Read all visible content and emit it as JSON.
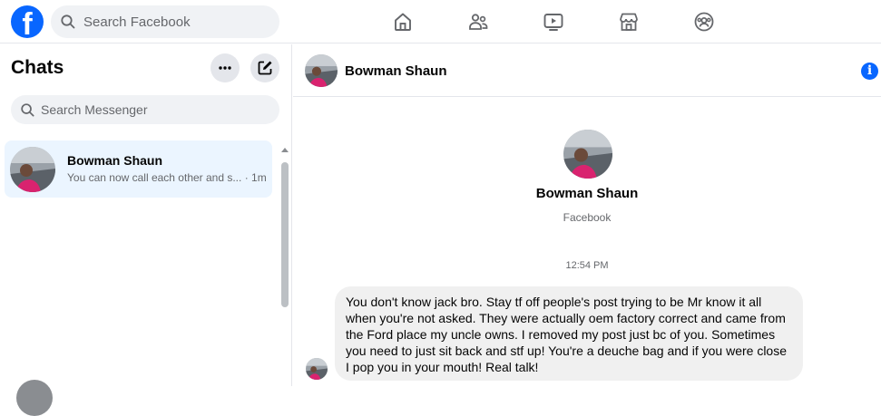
{
  "topbar": {
    "logo_letter": "f",
    "search_placeholder": "Search Facebook",
    "nav": [
      "home-icon",
      "friends-icon",
      "watch-icon",
      "marketplace-icon",
      "groups-icon"
    ]
  },
  "sidebar": {
    "title": "Chats",
    "search_placeholder": "Search Messenger",
    "conversations": [
      {
        "name": "Bowman Shaun",
        "preview": "You can now call each other and s...",
        "time": "· 1m",
        "selected": true
      }
    ]
  },
  "chat": {
    "header_name": "Bowman Shaun",
    "profile_name": "Bowman Shaun",
    "profile_subtitle": "Facebook",
    "timestamp": "12:54 PM",
    "messages": [
      {
        "sender": "Bowman Shaun",
        "text": "You don't know jack bro. Stay tf off people's post trying to be Mr know it all when you're not asked. They were actually oem factory correct and came from the Ford place my uncle owns. I removed my post just bc of you. Sometimes you need to just sit back and stf up! You're a deuche bag and if you were close I pop you in your mouth! Real talk!"
      }
    ]
  },
  "colors": {
    "brand": "#0866ff",
    "selected_bg": "#ebf5ff",
    "bubble_bg": "#f0f0f0",
    "muted": "#65676b"
  }
}
